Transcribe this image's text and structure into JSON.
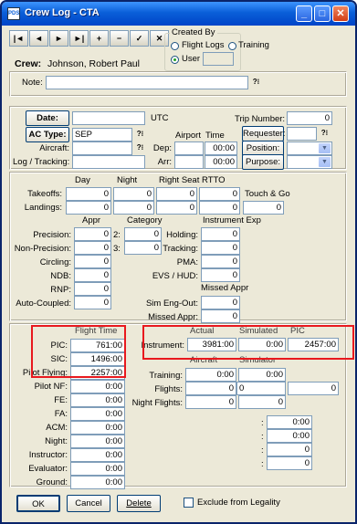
{
  "window": {
    "title": "Crew Log - CTA",
    "icon_text": "PDS"
  },
  "toolbar": {
    "buttons": [
      "|◄",
      "◄",
      "►",
      "►|",
      "+",
      "−",
      "✓",
      "✕"
    ]
  },
  "created_by": {
    "label": "Created By",
    "options": [
      "Flight Logs",
      "Training",
      "User"
    ],
    "selected": "User"
  },
  "crew": {
    "label": "Crew:",
    "name": "Johnson, Robert Paul"
  },
  "note": {
    "label": "Note:",
    "value": ""
  },
  "date": {
    "button": "Date:",
    "value": "",
    "utc": "UTC"
  },
  "ac_type": {
    "button": "AC Type:",
    "value": "SEP"
  },
  "aircraft": {
    "label": "Aircraft:",
    "value": ""
  },
  "log_tracking": {
    "label": "Log / Tracking:",
    "value": ""
  },
  "airport": {
    "header": "Airport",
    "time_header": "Time",
    "dep_label": "Dep:",
    "arr_label": "Arr:",
    "dep_time": "00:00",
    "arr_time": "00:00"
  },
  "trip": {
    "label": "Trip Number:",
    "value": "0",
    "requester_btn": "Requester:",
    "position_btn": "Position:",
    "purpose_btn": "Purpose:"
  },
  "landings_section": {
    "headers": [
      "Day",
      "Night",
      "Right Seat",
      "RTTO"
    ],
    "rows": [
      {
        "label": "Takeoffs:",
        "values": [
          "0",
          "0",
          "0",
          "0"
        ],
        "extra_label": "Touch & Go"
      },
      {
        "label": "Landings:",
        "values": [
          "0",
          "0",
          "0",
          "0"
        ],
        "extra_value": "0"
      }
    ]
  },
  "approaches": {
    "appr_header": "Appr",
    "category_header": "Category",
    "instrument_exp_header": "Instrument Exp",
    "left": [
      {
        "label": "Precision:",
        "value": "0"
      },
      {
        "label": "Non-Precision:",
        "value": "0"
      },
      {
        "label": "Circling:",
        "value": "0"
      },
      {
        "label": "NDB:",
        "value": "0"
      },
      {
        "label": "RNP:",
        "value": "0"
      },
      {
        "label": "Auto-Coupled:",
        "value": "0"
      }
    ],
    "category": [
      {
        "label": "2:",
        "value": "0"
      },
      {
        "label": "3:",
        "value": "0"
      }
    ],
    "right": [
      {
        "label": "Holding:",
        "value": "0"
      },
      {
        "label": "Tracking:",
        "value": "0"
      },
      {
        "label": "PMA:",
        "value": "0"
      },
      {
        "label": "EVS / HUD:",
        "value": "0"
      }
    ],
    "missed_header": "Missed Appr",
    "missed": [
      {
        "label": "Sim Eng-Out:",
        "value": "0"
      },
      {
        "label": "Missed Appr:",
        "value": "0"
      }
    ]
  },
  "flight_time": {
    "header": "Flight Time",
    "rows": [
      {
        "label": "PIC:",
        "value": "761:00"
      },
      {
        "label": "SIC:",
        "value": "1496:00"
      },
      {
        "label": "Pilot Flying:",
        "value": "2257:00"
      },
      {
        "label": "Pilot NF:",
        "value": "0:00"
      },
      {
        "label": "FE:",
        "value": "0:00"
      },
      {
        "label": "FA:",
        "value": "0:00"
      },
      {
        "label": "ACM:",
        "value": "0:00"
      },
      {
        "label": "Night:",
        "value": "0:00"
      },
      {
        "label": "Instructor:",
        "value": "0:00"
      },
      {
        "label": "Evaluator:",
        "value": "0:00"
      },
      {
        "label": "Ground:",
        "value": "0:00"
      }
    ]
  },
  "instrument": {
    "headers": [
      "Actual",
      "Simulated",
      "PIC"
    ],
    "label": "Instrument:",
    "values": [
      "3981:00",
      "0:00",
      "2457:00"
    ]
  },
  "aircraft_sim": {
    "headers": [
      "Aircraft",
      "Simulator"
    ],
    "rows": [
      {
        "label": "Training:",
        "values": [
          "0:00",
          "0:00"
        ]
      },
      {
        "label": "Flights:",
        "values": [
          "0",
          "0",
          "0"
        ]
      },
      {
        "label": "Night Flights:",
        "values": [
          "0",
          "0"
        ]
      }
    ]
  },
  "extra_fields": [
    "0:00",
    "0:00",
    "0",
    "0"
  ],
  "footer": {
    "ok": "OK",
    "cancel": "Cancel",
    "delete": "Delete",
    "exclude": "Exclude from Legality"
  }
}
